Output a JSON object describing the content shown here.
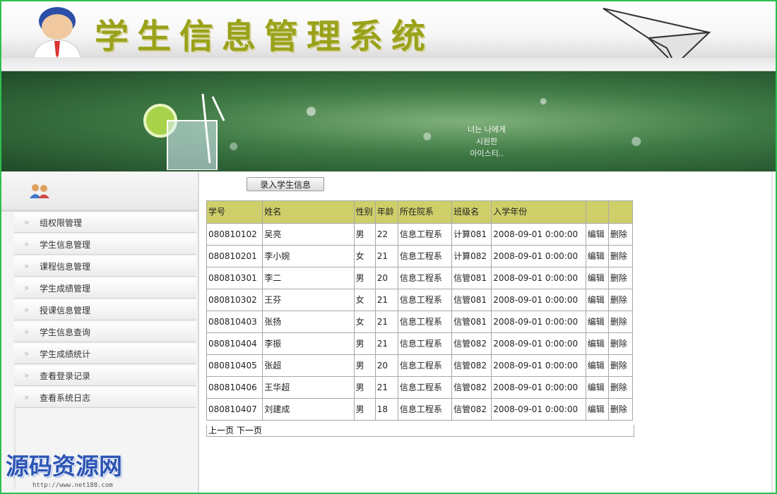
{
  "header": {
    "title": "学生信息管理系统"
  },
  "banner": {
    "text_lines": [
      "너는 나에게",
      "시원한",
      "아이스티.."
    ]
  },
  "sidebar": {
    "items": [
      {
        "label": "组权限管理"
      },
      {
        "label": "学生信息管理"
      },
      {
        "label": "课程信息管理"
      },
      {
        "label": "学生成绩管理"
      },
      {
        "label": "授课信息管理"
      },
      {
        "label": "学生信息查询"
      },
      {
        "label": "学生成绩统计"
      },
      {
        "label": "查看登录记录"
      },
      {
        "label": "查看系统日志"
      }
    ],
    "chevron": "»"
  },
  "toolbar": {
    "add_label": "录入学生信息"
  },
  "table": {
    "headers": [
      "学号",
      "姓名",
      "性别",
      "年龄",
      "所在院系",
      "班级名",
      "入学年份",
      "",
      ""
    ],
    "rows": [
      {
        "id": "080810102",
        "name": "吴亮",
        "gender": "男",
        "age": "22",
        "dept": "信息工程系",
        "cls": "计算081",
        "year": "2008-09-01 0:00:00"
      },
      {
        "id": "080810201",
        "name": "李小婉",
        "gender": "女",
        "age": "21",
        "dept": "信息工程系",
        "cls": "计算082",
        "year": "2008-09-01 0:00:00"
      },
      {
        "id": "080810301",
        "name": "李二",
        "gender": "男",
        "age": "20",
        "dept": "信息工程系",
        "cls": "信管081",
        "year": "2008-09-01 0:00:00"
      },
      {
        "id": "080810302",
        "name": "王芬",
        "gender": "女",
        "age": "21",
        "dept": "信息工程系",
        "cls": "信管081",
        "year": "2008-09-01 0:00:00"
      },
      {
        "id": "080810403",
        "name": "张扬",
        "gender": "女",
        "age": "21",
        "dept": "信息工程系",
        "cls": "信管081",
        "year": "2008-09-01 0:00:00"
      },
      {
        "id": "080810404",
        "name": "李振",
        "gender": "男",
        "age": "21",
        "dept": "信息工程系",
        "cls": "信管082",
        "year": "2008-09-01 0:00:00"
      },
      {
        "id": "080810405",
        "name": "张超",
        "gender": "男",
        "age": "20",
        "dept": "信息工程系",
        "cls": "信管082",
        "year": "2008-09-01 0:00:00"
      },
      {
        "id": "080810406",
        "name": "王华超",
        "gender": "男",
        "age": "21",
        "dept": "信息工程系",
        "cls": "信管082",
        "year": "2008-09-01 0:00:00"
      },
      {
        "id": "080810407",
        "name": "刘建成",
        "gender": "男",
        "age": "18",
        "dept": "信息工程系",
        "cls": "信管082",
        "year": "2008-09-01 0:00:00"
      }
    ],
    "edit_label": "编辑",
    "delete_label": "删除"
  },
  "pager": {
    "prev": "上一页",
    "next": "下一页"
  },
  "watermark": {
    "brand": "源码资源网",
    "url": "http://www.net188.com"
  },
  "colors": {
    "frame": "#2fbf4f",
    "header_cell": "#cfcf6a",
    "title": "#9aa21a"
  }
}
